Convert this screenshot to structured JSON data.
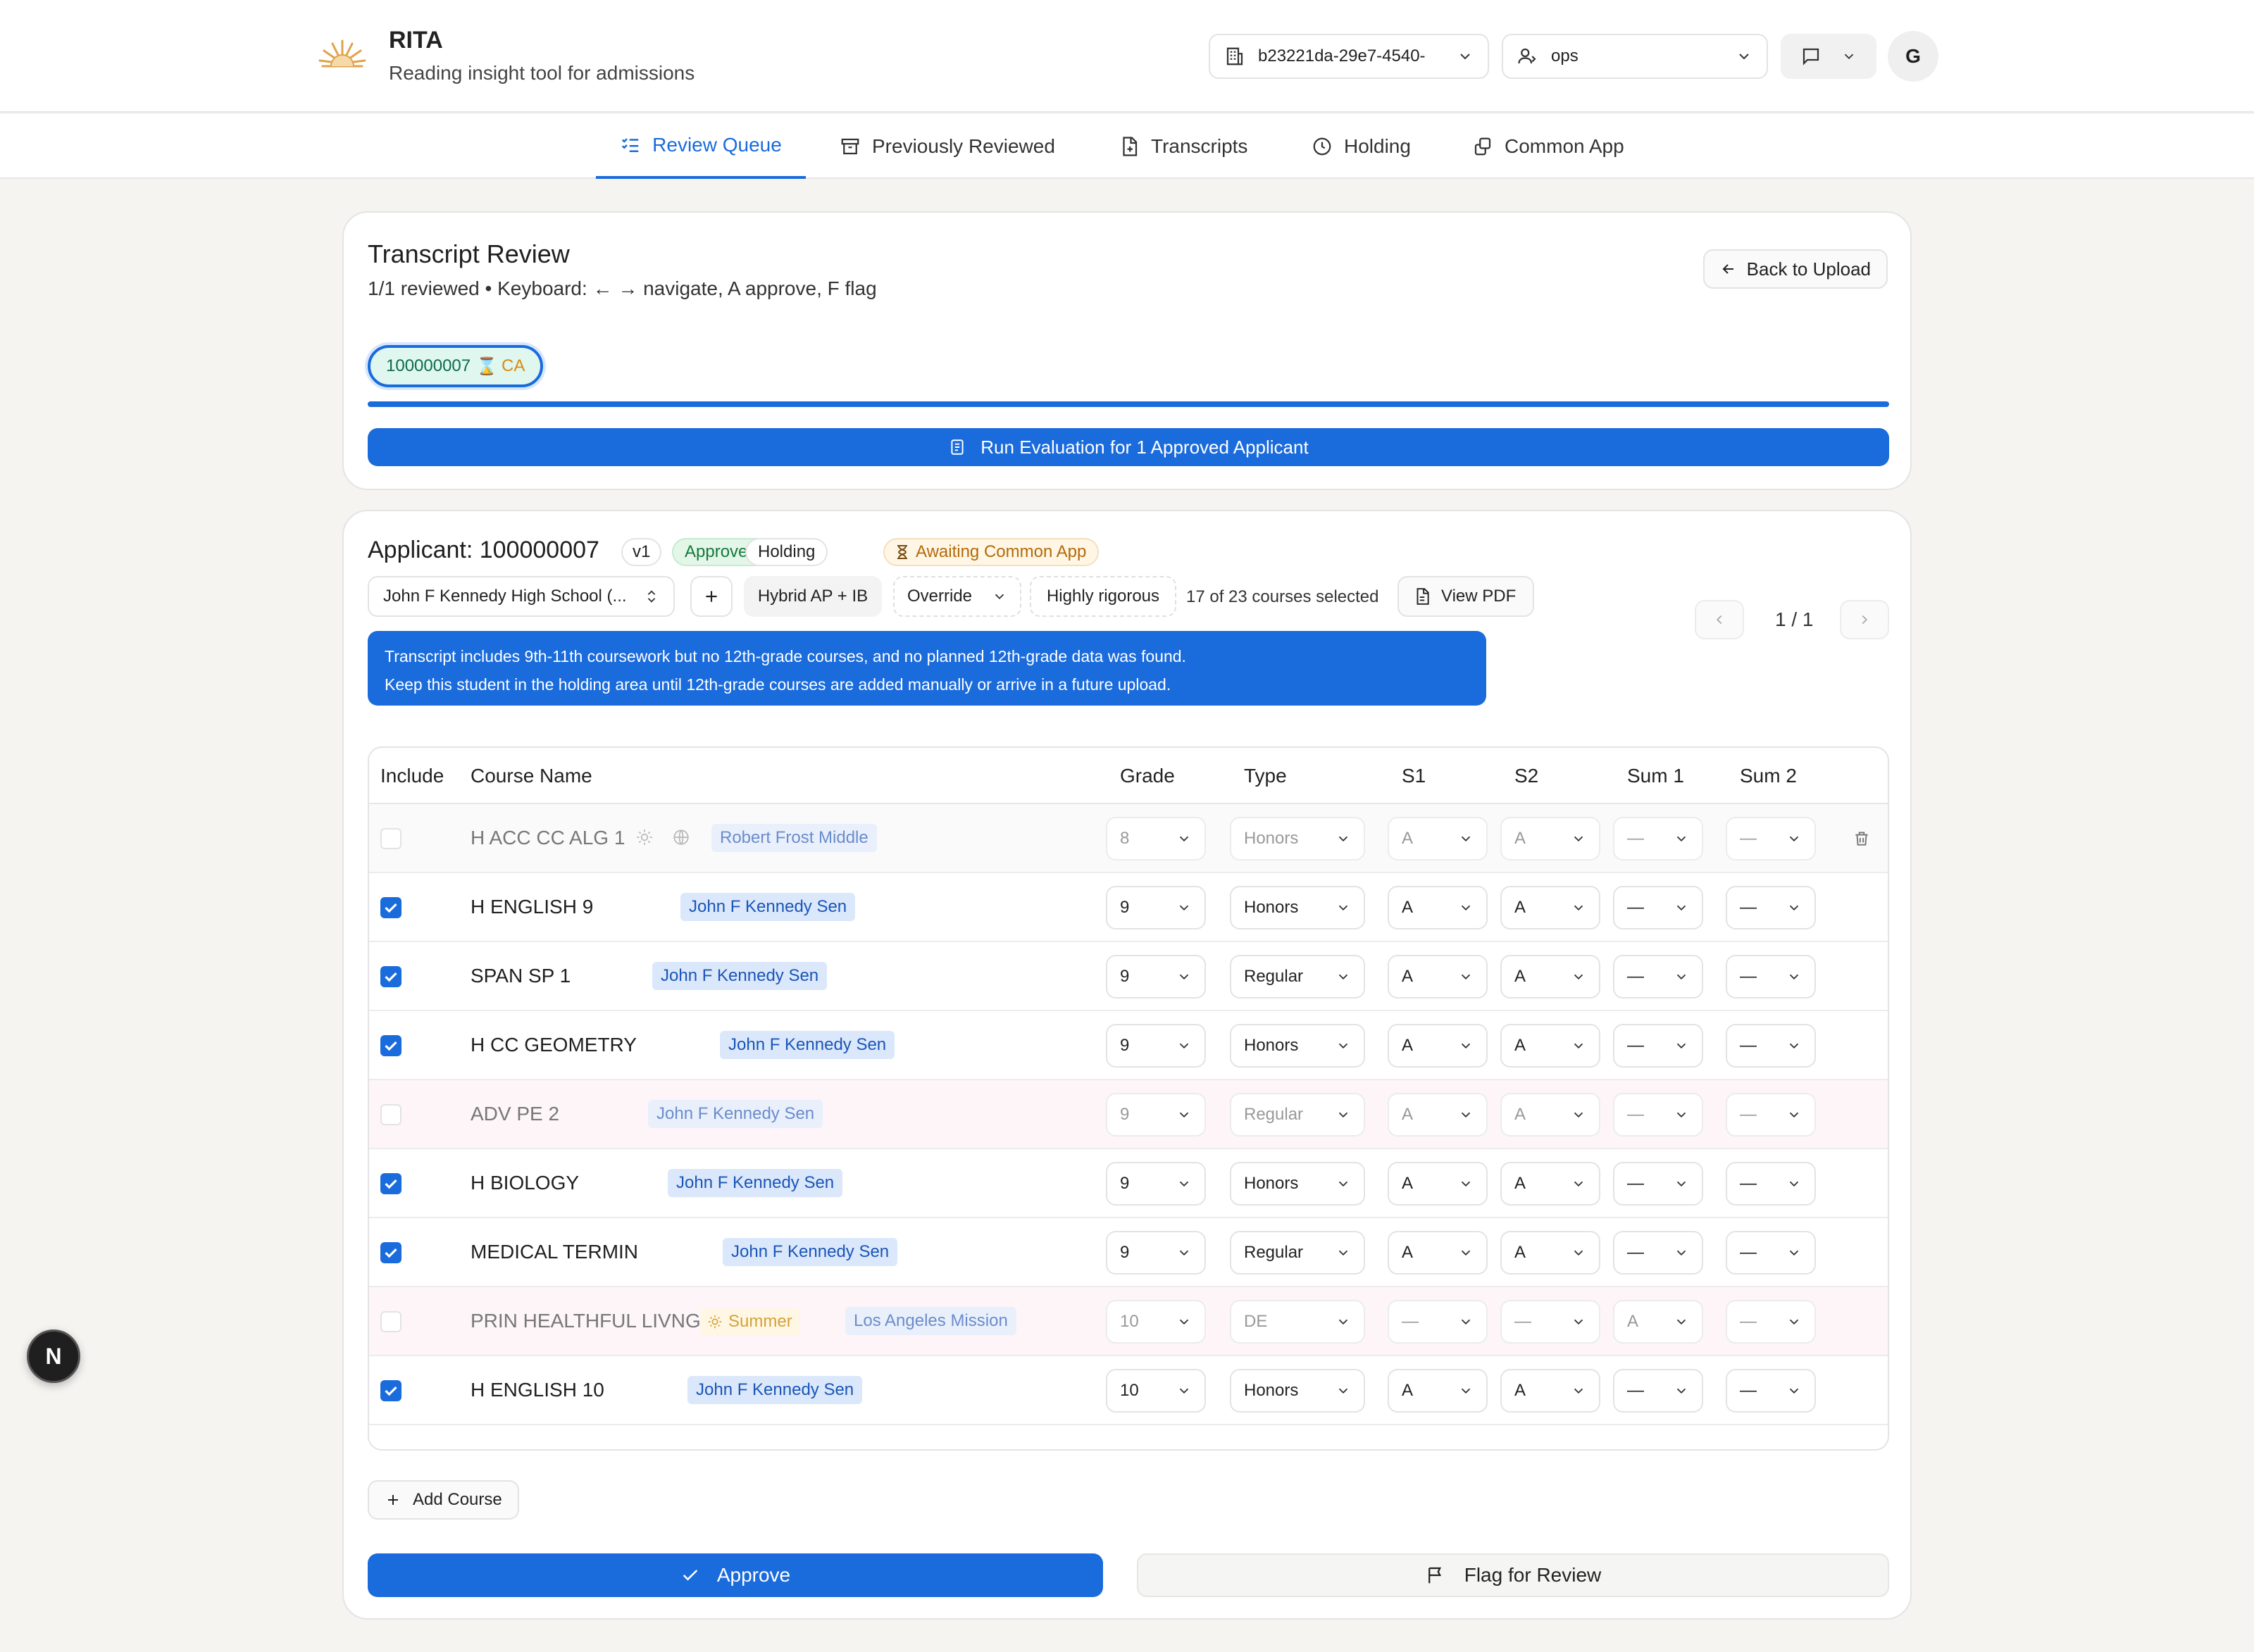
{
  "header": {
    "title": "RITA",
    "subtitle": "Reading insight tool for admissions",
    "org_select": "b23221da-29e7-4540-",
    "role_select": "ops",
    "avatar_initial": "G"
  },
  "nav": {
    "tabs": [
      {
        "label": "Review Queue",
        "active": true
      },
      {
        "label": "Previously Reviewed",
        "active": false
      },
      {
        "label": "Transcripts",
        "active": false
      },
      {
        "label": "Holding",
        "active": false
      },
      {
        "label": "Common App",
        "active": false
      }
    ]
  },
  "review": {
    "title": "Transcript Review",
    "subtitle": "1/1 reviewed • Keyboard: ← → navigate, A approve, F flag",
    "back_button": "Back to Upload",
    "applicant_chip": {
      "id": "100000007",
      "hourglass": "⌛",
      "tag": "CA"
    },
    "progress_percent": 100,
    "run_button": "Run Evaluation for 1 Approved Applicant"
  },
  "applicant": {
    "title": "Applicant: 100000007",
    "version": "v1",
    "status_approved": "Approved",
    "status_holding": "Holding",
    "status_awaiting": "Awaiting Common App",
    "school_select": "John F Kennedy High School (...",
    "add_symbol": "+",
    "curriculum": "Hybrid AP + IB",
    "override": "Override",
    "rigor": "Highly rigorous",
    "selected_count": "17 of 23 courses selected",
    "view_pdf": "View PDF",
    "pager": "1 / 1",
    "notice_line1": "Transcript includes 9th-11th coursework but no 12th-grade courses, and no planned 12th-grade data was found.",
    "notice_line2": "Keep this student in the holding area until 12th-grade courses are added manually or arrive in a future upload."
  },
  "table": {
    "headers": {
      "include": "Include",
      "course": "Course Name",
      "grade": "Grade",
      "type": "Type",
      "s1": "S1",
      "s2": "S2",
      "sum1": "Sum 1",
      "sum2": "Sum 2"
    },
    "rows": [
      {
        "name": "H ACC CC ALG 1",
        "school": "Robert Frost Middle",
        "grade": "8",
        "type": "Honors",
        "s1": "A",
        "s2": "A",
        "sum1": "—",
        "sum2": "—",
        "included": false
      },
      {
        "name": "H ENGLISH 9",
        "school": "John F Kennedy Sen",
        "grade": "9",
        "type": "Honors",
        "s1": "A",
        "s2": "A",
        "sum1": "—",
        "sum2": "—",
        "included": true
      },
      {
        "name": "SPAN SP 1",
        "school": "John F Kennedy Sen",
        "grade": "9",
        "type": "Regular",
        "s1": "A",
        "s2": "A",
        "sum1": "—",
        "sum2": "—",
        "included": true
      },
      {
        "name": "H CC GEOMETRY",
        "school": "John F Kennedy Sen",
        "grade": "9",
        "type": "Honors",
        "s1": "A",
        "s2": "A",
        "sum1": "—",
        "sum2": "—",
        "included": true
      },
      {
        "name": "ADV PE 2",
        "school": "John F Kennedy Sen",
        "grade": "9",
        "type": "Regular",
        "s1": "A",
        "s2": "A",
        "sum1": "—",
        "sum2": "—",
        "included": false
      },
      {
        "name": "H BIOLOGY",
        "school": "John F Kennedy Sen",
        "grade": "9",
        "type": "Honors",
        "s1": "A",
        "s2": "A",
        "sum1": "—",
        "sum2": "—",
        "included": true
      },
      {
        "name": "MEDICAL TERMIN",
        "school": "John F Kennedy Sen",
        "grade": "9",
        "type": "Regular",
        "s1": "A",
        "s2": "A",
        "sum1": "—",
        "sum2": "—",
        "included": true
      },
      {
        "name": "PRIN HEALTHFUL LIVNG",
        "summer": "Summer",
        "school": "Los Angeles Mission",
        "grade": "10",
        "type": "DE",
        "s1": "—",
        "s2": "—",
        "sum1": "A",
        "sum2": "—",
        "included": false
      },
      {
        "name": "H ENGLISH 10",
        "school": "John F Kennedy Sen",
        "grade": "10",
        "type": "Honors",
        "s1": "A",
        "s2": "A",
        "sum1": "—",
        "sum2": "—",
        "included": true
      }
    ]
  },
  "actions": {
    "add_course": "Add Course",
    "approve": "Approve",
    "flag": "Flag for Review"
  },
  "floating_badge": "N",
  "colors": {
    "accent": "#1a6bdc",
    "approved_bg": "#e3f6e8",
    "awaiting_text": "#b46a08",
    "logo": "#e0a24a"
  }
}
